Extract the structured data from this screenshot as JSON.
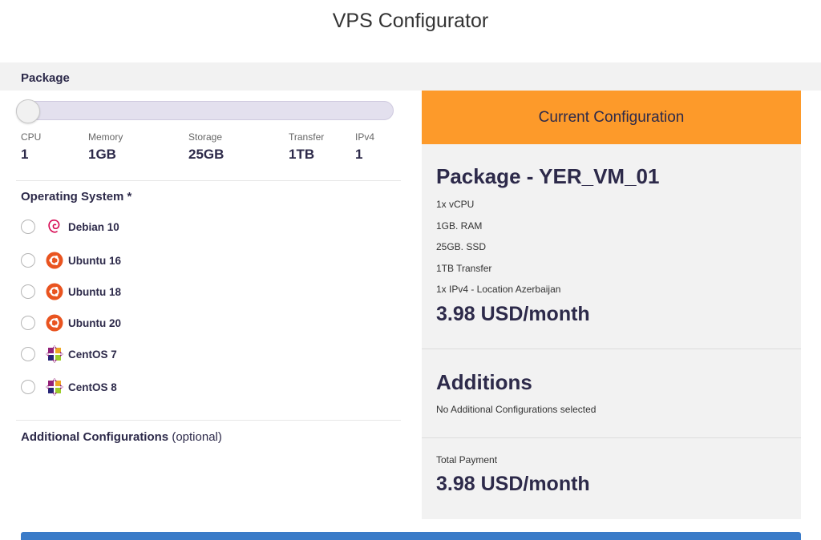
{
  "page": {
    "title": "VPS Configurator"
  },
  "package": {
    "heading": "Package",
    "slider_level": 0,
    "specs": [
      {
        "label": "CPU",
        "value": "1"
      },
      {
        "label": "Memory",
        "value": "1GB"
      },
      {
        "label": "Storage",
        "value": "25GB"
      },
      {
        "label": "Transfer",
        "value": "1TB"
      },
      {
        "label": "IPv4",
        "value": "1"
      }
    ]
  },
  "os": {
    "heading": "Operating System *",
    "options": [
      {
        "label": "Debian 10",
        "icon": "debian-icon",
        "selected": false
      },
      {
        "label": "Ubuntu 16",
        "icon": "ubuntu-icon",
        "selected": false
      },
      {
        "label": "Ubuntu 18",
        "icon": "ubuntu-icon",
        "selected": false
      },
      {
        "label": "Ubuntu 20",
        "icon": "ubuntu-icon",
        "selected": false
      },
      {
        "label": "CentOS 7",
        "icon": "centos-icon",
        "selected": false
      },
      {
        "label": "CentOS 8",
        "icon": "centos-icon",
        "selected": false
      }
    ]
  },
  "additional": {
    "heading": "Additional Configurations",
    "optional": "(optional)"
  },
  "summary": {
    "header": "Current Configuration",
    "package_title": "Package - YER_VM_01",
    "lines": [
      "1x vCPU",
      "1GB. RAM",
      "25GB. SSD",
      "1TB Transfer",
      "1x IPv4 - Location Azerbaijan"
    ],
    "price": "3.98 USD/month",
    "additions_title": "Additions",
    "additions_text": "No Additional Configurations selected",
    "total_label": "Total Payment",
    "total_price": "3.98 USD/month"
  },
  "colors": {
    "accent": "#fd9a2a",
    "text": "#2d2a4a",
    "panel_bg": "#f2f2f2",
    "ubuntu": "#e95420",
    "debian": "#d70a53",
    "button": "#3a7bc8"
  }
}
